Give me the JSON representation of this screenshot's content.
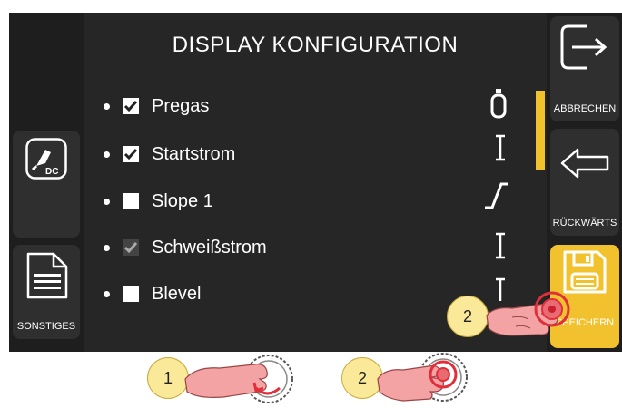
{
  "screen": {
    "title": "DISPLAY KONFIGURATION",
    "items": [
      {
        "label": "Pregas",
        "checked": true,
        "icon": "gas-bottle-icon"
      },
      {
        "label": "Startstrom",
        "checked": true,
        "icon": "start-current-icon"
      },
      {
        "label": "Slope 1",
        "checked": false,
        "icon": "slope-icon"
      },
      {
        "label": "Schweißstrom",
        "checked": true,
        "checkbox_disabled": true,
        "icon": "welding-current-icon"
      },
      {
        "label": "Blevel",
        "checked": false,
        "icon": "blevel-icon"
      }
    ]
  },
  "left_buttons": {
    "dc_label": "DC",
    "sonstiges_label": "SONSTIGES"
  },
  "right_buttons": {
    "abbrechen_label": "ABBRECHEN",
    "rueckwaerts_label": "RÜCKWÄRTS",
    "speichern_label": "SPEICHERN"
  },
  "instructions": {
    "step1": "1",
    "step2": "2",
    "step2_screen": "2"
  },
  "colors": {
    "accent": "#f2c12e",
    "background": "#262626",
    "finger": "#f3a3a3",
    "badge": "#fbe99a"
  }
}
